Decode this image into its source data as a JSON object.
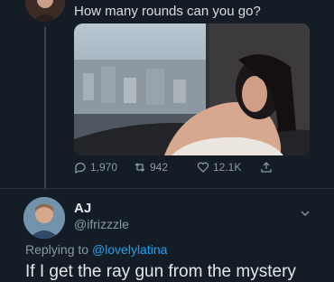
{
  "tweet": {
    "text": "How many rounds can you go?",
    "stats": {
      "replies": "1,970",
      "retweets": "942",
      "likes": "12.1K"
    }
  },
  "reply": {
    "author_name": "AJ",
    "author_handle": "@ifrizzzle",
    "replying_prefix": "Replying to ",
    "replying_to": "@lovelylatina",
    "text": "If I get the ray gun from the mystery"
  },
  "colors": {
    "background": "#141d26",
    "link": "#1da1f2",
    "muted": "#8899a6"
  }
}
